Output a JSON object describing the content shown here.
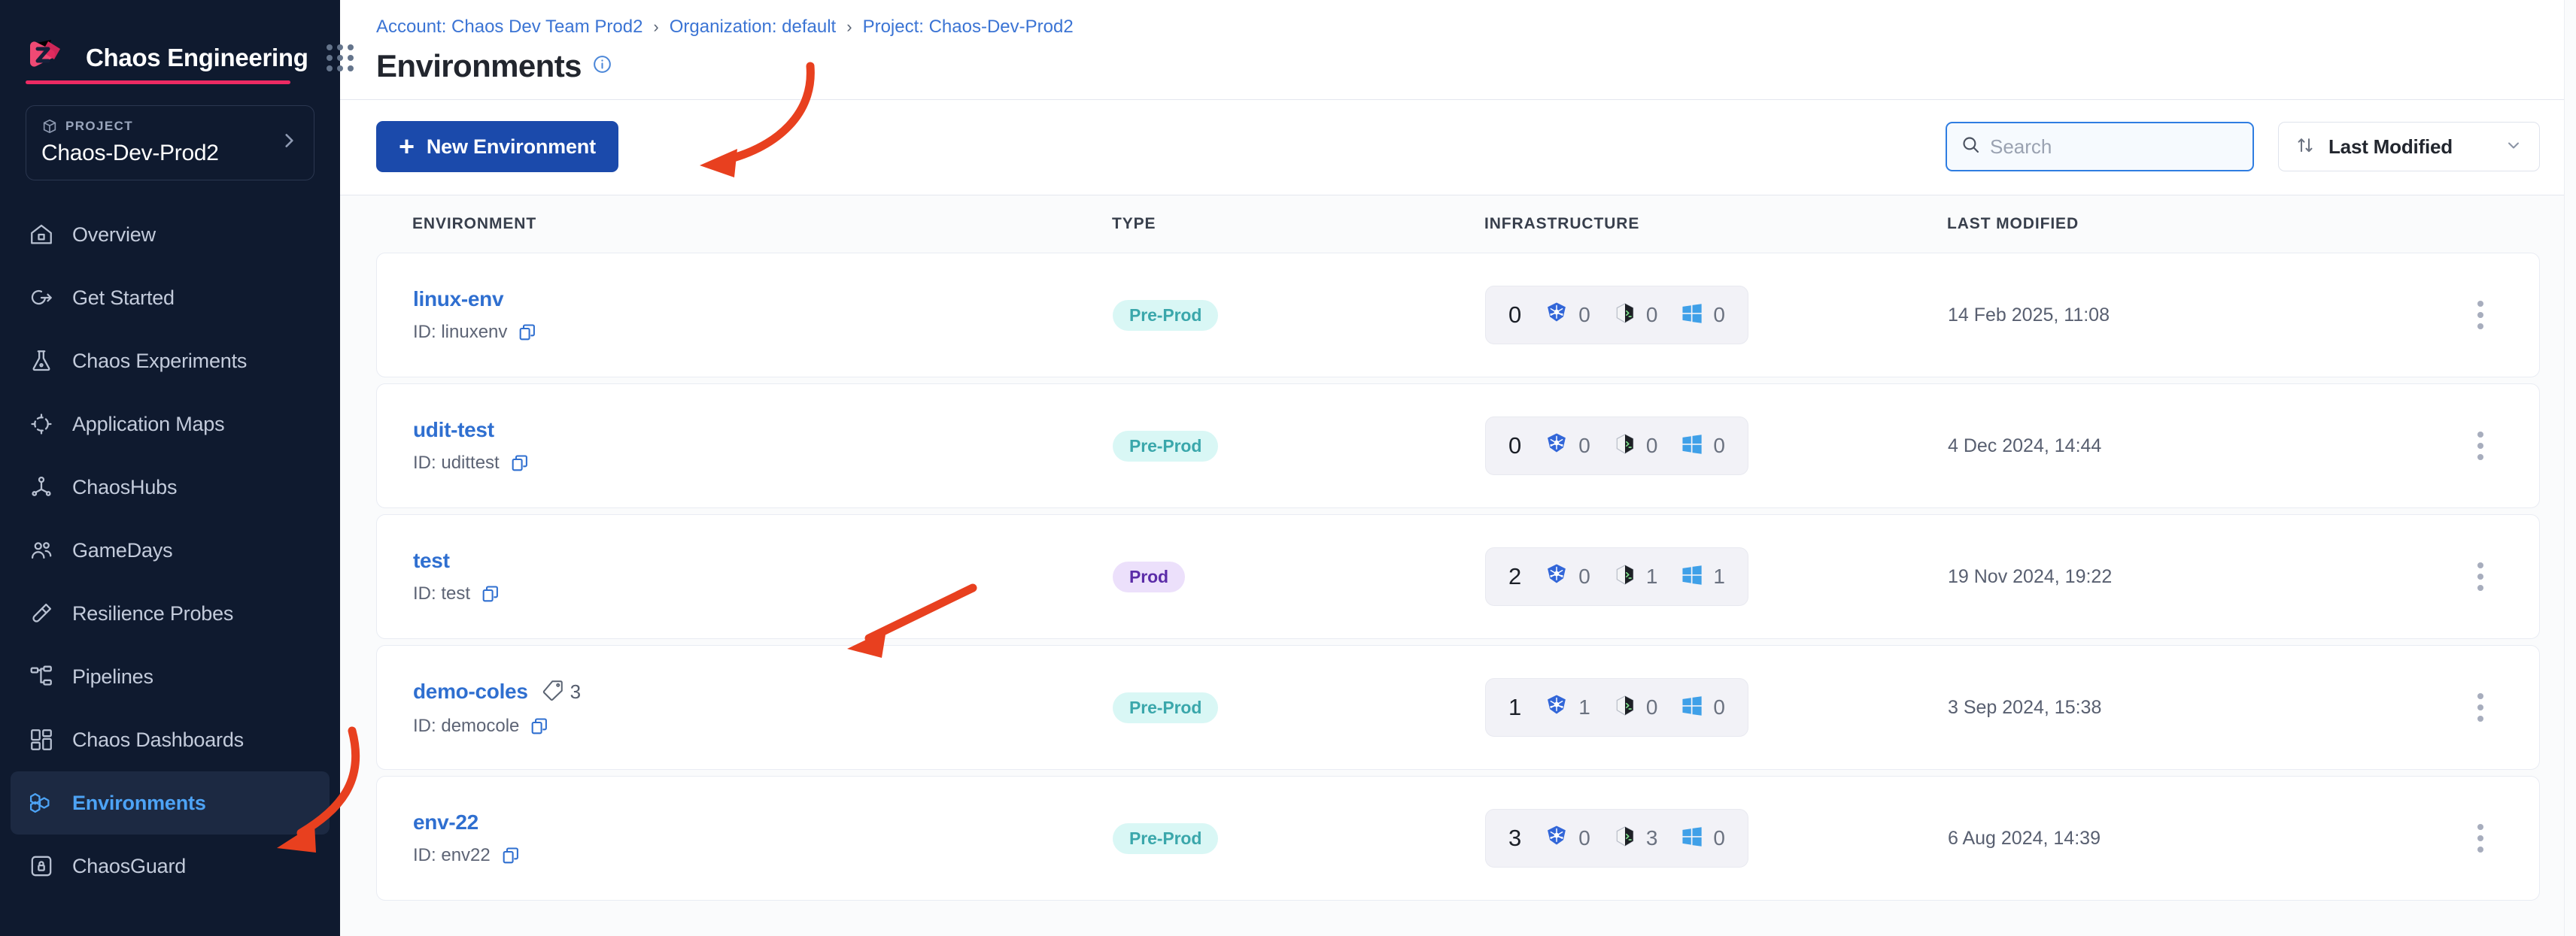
{
  "sidebar": {
    "brand": {
      "title": "Chaos Engineering",
      "logo_color": "#ec3a6e",
      "accent_color": "#ec2a63"
    },
    "project": {
      "label": "PROJECT",
      "name": "Chaos-Dev-Prod2"
    },
    "items": [
      {
        "label": "Overview",
        "icon": "home-icon",
        "active": false
      },
      {
        "label": "Get Started",
        "icon": "get-started-icon",
        "active": false
      },
      {
        "label": "Chaos Experiments",
        "icon": "flask-icon",
        "active": false
      },
      {
        "label": "Application Maps",
        "icon": "target-icon",
        "active": false
      },
      {
        "label": "ChaosHubs",
        "icon": "hub-network-icon",
        "active": false
      },
      {
        "label": "GameDays",
        "icon": "users-icon",
        "active": false
      },
      {
        "label": "Resilience Probes",
        "icon": "test-tube-icon",
        "active": false
      },
      {
        "label": "Pipelines",
        "icon": "pipeline-icon",
        "active": false
      },
      {
        "label": "Chaos Dashboards",
        "icon": "dashboard-grid-icon",
        "active": false
      },
      {
        "label": "Environments",
        "icon": "hexagons-icon",
        "active": true
      },
      {
        "label": "ChaosGuard",
        "icon": "lock-shield-icon",
        "active": false
      }
    ]
  },
  "header": {
    "breadcrumb": [
      "Account: Chaos Dev Team Prod2",
      "Organization: default",
      "Project: Chaos-Dev-Prod2"
    ],
    "breadcrumb_separator": "›",
    "title": "Environments",
    "info_icon": "info-circle-icon"
  },
  "toolbar": {
    "new_environment_label": "New Environment",
    "new_environment_plus": "+",
    "search": {
      "placeholder": "Search",
      "value": ""
    },
    "sort": {
      "label": "Last Modified",
      "icon": "sort-arrows-icon",
      "chevron": "chevron-down-icon"
    }
  },
  "table": {
    "columns": [
      "ENVIRONMENT",
      "TYPE",
      "INFRASTRUCTURE",
      "LAST MODIFIED"
    ],
    "id_prefix": "ID: ",
    "rows": [
      {
        "name": "linux-env",
        "id": "linuxenv",
        "tags": null,
        "type": "Pre-Prod",
        "type_variant": "preprod",
        "infra_total": "0",
        "infra": [
          {
            "platform": "kubernetes-icon",
            "count": "0"
          },
          {
            "platform": "linux-terminal-icon",
            "count": "0"
          },
          {
            "platform": "windows-icon",
            "count": "0"
          }
        ],
        "last_modified": "14 Feb 2025, 11:08"
      },
      {
        "name": "udit-test",
        "id": "udittest",
        "tags": null,
        "type": "Pre-Prod",
        "type_variant": "preprod",
        "infra_total": "0",
        "infra": [
          {
            "platform": "kubernetes-icon",
            "count": "0"
          },
          {
            "platform": "linux-terminal-icon",
            "count": "0"
          },
          {
            "platform": "windows-icon",
            "count": "0"
          }
        ],
        "last_modified": "4 Dec 2024, 14:44"
      },
      {
        "name": "test",
        "id": "test",
        "tags": null,
        "type": "Prod",
        "type_variant": "prod",
        "infra_total": "2",
        "infra": [
          {
            "platform": "kubernetes-icon",
            "count": "0"
          },
          {
            "platform": "linux-terminal-icon",
            "count": "1"
          },
          {
            "platform": "windows-icon",
            "count": "1"
          }
        ],
        "last_modified": "19 Nov 2024, 19:22"
      },
      {
        "name": "demo-coles",
        "id": "democole",
        "tags": "3",
        "type": "Pre-Prod",
        "type_variant": "preprod",
        "infra_total": "1",
        "infra": [
          {
            "platform": "kubernetes-icon",
            "count": "1"
          },
          {
            "platform": "linux-terminal-icon",
            "count": "0"
          },
          {
            "platform": "windows-icon",
            "count": "0"
          }
        ],
        "last_modified": "3 Sep 2024, 15:38"
      },
      {
        "name": "env-22",
        "id": "env22",
        "tags": null,
        "type": "Pre-Prod",
        "type_variant": "preprod",
        "infra_total": "3",
        "infra": [
          {
            "platform": "kubernetes-icon",
            "count": "0"
          },
          {
            "platform": "linux-terminal-icon",
            "count": "3"
          },
          {
            "platform": "windows-icon",
            "count": "0"
          }
        ],
        "last_modified": "6 Aug 2024, 14:39"
      }
    ]
  },
  "annotations": {
    "color": "#e8401f",
    "arrows": [
      {
        "name": "arrow-to-new-environment-button"
      },
      {
        "name": "arrow-to-test-row"
      },
      {
        "name": "arrow-to-environments-nav-item"
      }
    ]
  }
}
